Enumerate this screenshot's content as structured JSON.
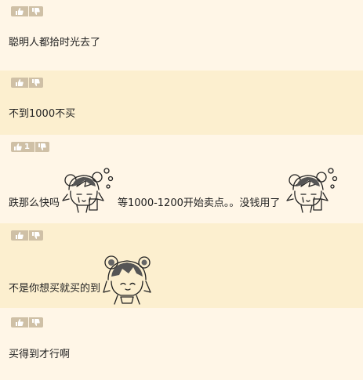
{
  "comments": [
    {
      "upvotes": "",
      "text": "聪明人都拾时光去了"
    },
    {
      "upvotes": "",
      "text": "不到1000不买"
    },
    {
      "upvotes": "1",
      "text_before": "跌那么快吗",
      "text_middle": "等1000-1200开始卖点。。没钱用了"
    },
    {
      "upvotes": "",
      "text": "不是你想买就买的到"
    },
    {
      "upvotes": "",
      "text": "买得到才行啊"
    }
  ],
  "icons": {
    "upvote": "thumbs-up-icon",
    "downvote": "thumbs-down-icon",
    "sticker_crying": "crying-chibi-girl-sticker",
    "sticker_smug": "smug-chibi-girl-sticker"
  },
  "colors": {
    "page_bg": "#fff6e7",
    "alt_row_bg": "#fcefcf",
    "vote_button": "#cfc0a6"
  }
}
